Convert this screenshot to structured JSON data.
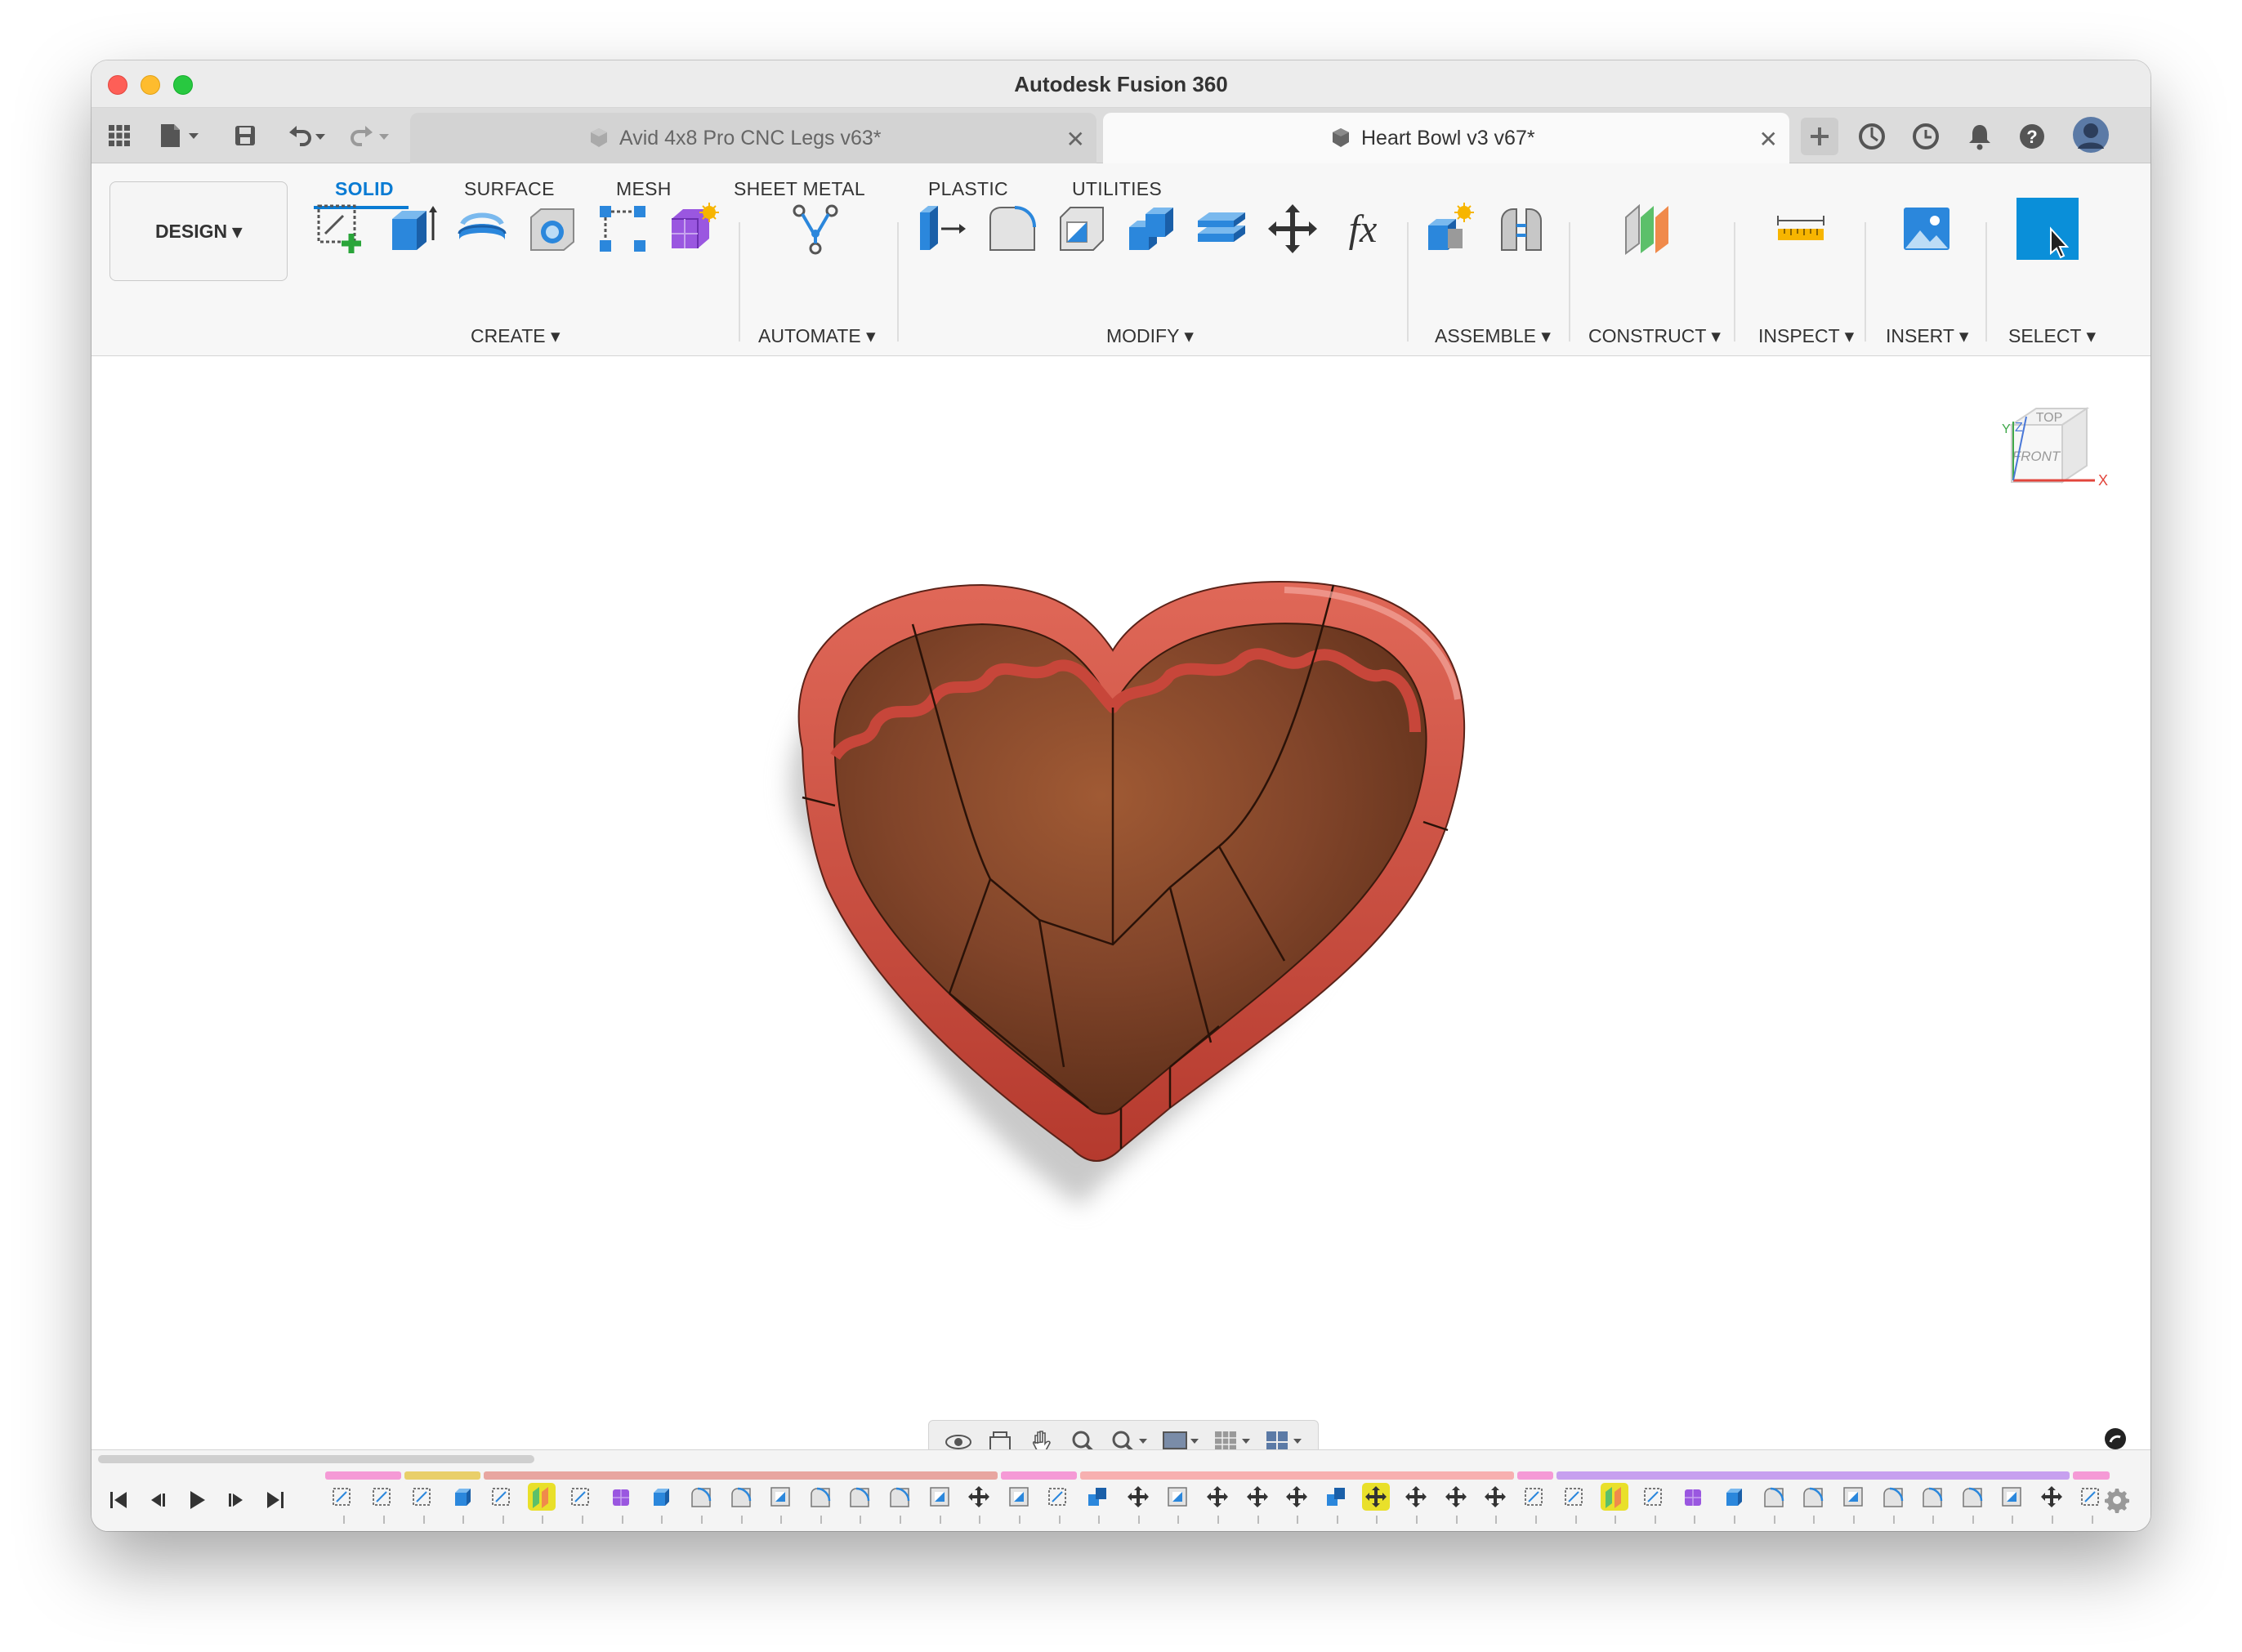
{
  "window": {
    "title": "Autodesk Fusion 360"
  },
  "tabs": [
    {
      "label": "Avid 4x8 Pro CNC Legs v63*",
      "active": false
    },
    {
      "label": "Heart Bowl v3 v67*",
      "active": true
    }
  ],
  "ribbon": {
    "workspace": "DESIGN ▾",
    "tabs": [
      "SOLID",
      "SURFACE",
      "MESH",
      "SHEET METAL",
      "PLASTIC",
      "UTILITIES"
    ],
    "groups": {
      "create": "CREATE ▾",
      "automate": "AUTOMATE ▾",
      "modify": "MODIFY ▾",
      "assemble": "ASSEMBLE ▾",
      "construct": "CONSTRUCT ▾",
      "inspect": "INSPECT ▾",
      "insert": "INSERT ▾",
      "select": "SELECT ▾"
    }
  },
  "viewcube": {
    "top": "TOP",
    "front": "FRONT",
    "axis_x": "X",
    "axis_y": "Y",
    "axis_z": "Z"
  },
  "colors": {
    "accent": "#0a7bd3",
    "bowl_rim": "#c7463a",
    "bowl_wood": "#7a3e22",
    "highlight": "#e9e02a"
  },
  "timeline": {
    "features": [
      "sketch",
      "sketch",
      "sketch",
      "extrude",
      "sketch",
      "plane",
      "sketch",
      "form",
      "extrude",
      "fillet",
      "fillet",
      "shell",
      "fillet",
      "fillet",
      "fillet",
      "shell",
      "move",
      "shell",
      "sketch",
      "combine",
      "move",
      "shell",
      "move",
      "move",
      "move",
      "combine",
      "move",
      "move",
      "move",
      "move",
      "sketch",
      "sketch",
      "plane",
      "sketch",
      "form",
      "extrude",
      "fillet",
      "fillet",
      "shell",
      "fillet",
      "fillet",
      "fillet",
      "shell",
      "move",
      "sketch"
    ]
  }
}
